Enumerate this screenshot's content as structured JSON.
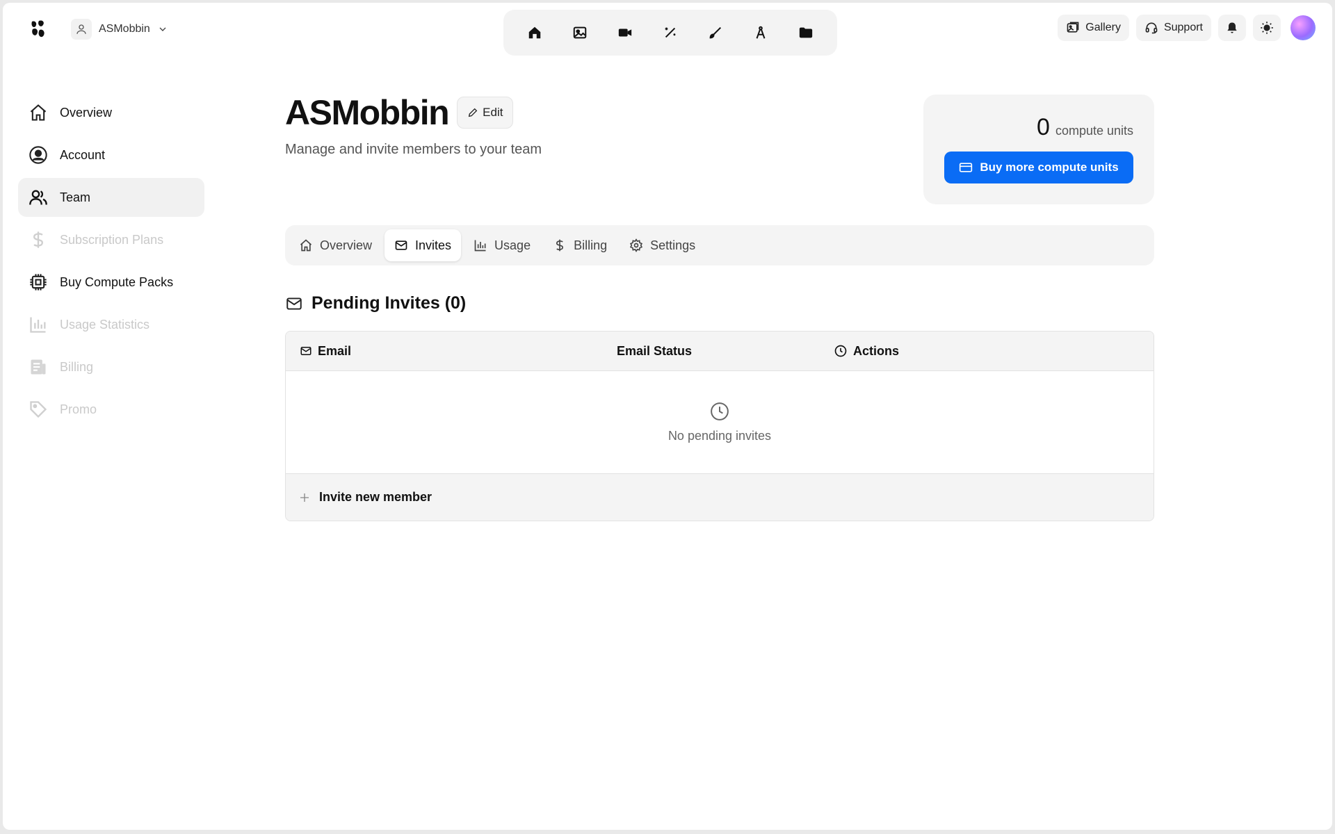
{
  "header": {
    "team_switcher": {
      "name": "ASMobbin"
    },
    "top_nav_icons": [
      "home-icon",
      "image-icon",
      "video-icon",
      "magic-wand-icon",
      "brush-icon",
      "compass-icon",
      "folder-icon"
    ],
    "gallery_label": "Gallery",
    "support_label": "Support"
  },
  "sidebar": {
    "items": [
      {
        "label": "Overview",
        "icon": "home-icon",
        "state": "normal"
      },
      {
        "label": "Account",
        "icon": "user-circle-icon",
        "state": "normal"
      },
      {
        "label": "Team",
        "icon": "users-icon",
        "state": "active"
      },
      {
        "label": "Subscription Plans",
        "icon": "dollar-icon",
        "state": "disabled"
      },
      {
        "label": "Buy Compute Packs",
        "icon": "cpu-icon",
        "state": "normal"
      },
      {
        "label": "Usage Statistics",
        "icon": "bar-chart-icon",
        "state": "disabled"
      },
      {
        "label": "Billing",
        "icon": "receipt-icon",
        "state": "disabled"
      },
      {
        "label": "Promo",
        "icon": "tag-icon",
        "state": "disabled"
      }
    ]
  },
  "main": {
    "title": "ASMobbin",
    "edit_label": "Edit",
    "subtitle": "Manage and invite members to your team",
    "compute": {
      "units": "0",
      "units_label": "compute units",
      "buy_label": "Buy more compute units"
    },
    "tabs": [
      {
        "label": "Overview",
        "icon": "home-icon"
      },
      {
        "label": "Invites",
        "icon": "mail-icon",
        "active": true
      },
      {
        "label": "Usage",
        "icon": "bar-chart-icon"
      },
      {
        "label": "Billing",
        "icon": "dollar-icon"
      },
      {
        "label": "Settings",
        "icon": "gear-icon"
      }
    ],
    "section_title": "Pending Invites (0)",
    "table": {
      "columns": [
        "Email",
        "Email Status",
        "Actions"
      ],
      "empty_text": "No pending invites",
      "invite_label": "Invite new member"
    }
  },
  "colors": {
    "accent": "#0a6cf5",
    "disabled_text": "#c9c9c9"
  }
}
